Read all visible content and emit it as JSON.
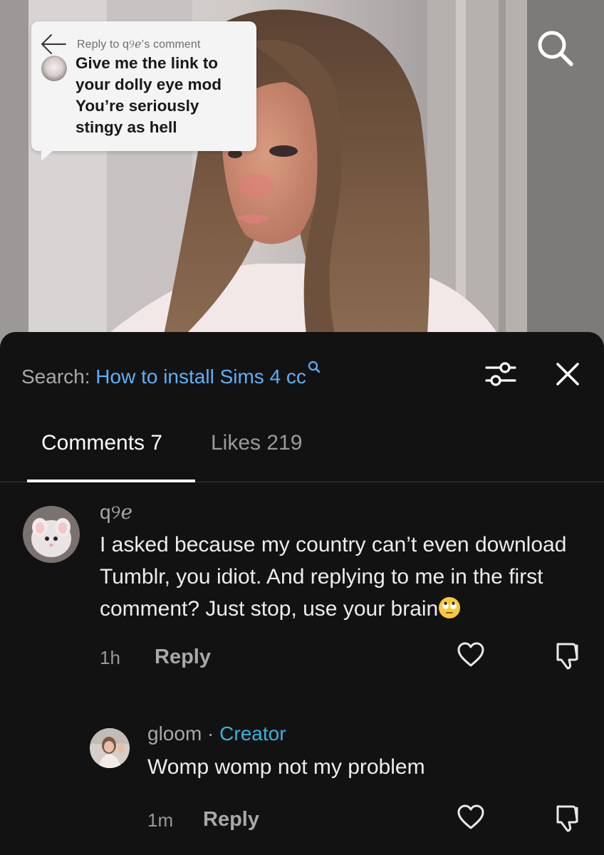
{
  "reply_sticker": {
    "label": "Reply to q୨ℯ’s comment",
    "text": "Give me the link to\nyour dolly eye mod\nYou’re seriously\nstingy as hell"
  },
  "sheet": {
    "search_prefix": "Search:",
    "search_query": "How to install Sims 4 cc",
    "tabs": [
      {
        "label": "Comments 7",
        "active": true
      },
      {
        "label": "Likes 219",
        "active": false
      }
    ]
  },
  "comments": [
    {
      "username": "q୨ℯ",
      "text": "I asked because my country can’t even download Tumblr, you idiot. And replying to me in the first comment? Just stop, use your brain",
      "emoji": "face-with-rolling-eyes",
      "time": "1h",
      "reply_label": "Reply"
    },
    {
      "username": "gloom",
      "separator": "·",
      "badge": "Creator",
      "text": "Womp womp not my problem",
      "time": "1m",
      "reply_label": "Reply"
    }
  ],
  "icons": {
    "top_search": "search-icon",
    "back": "back-arrow-icon",
    "search_magnifier": "search-mini-icon",
    "filter": "filter-sliders-icon",
    "close": "close-icon",
    "heart": "heart-icon",
    "dislike": "dislike-icon"
  },
  "colors": {
    "sheet_background": "#121212",
    "search_query": "#5db1f7",
    "creator_badge": "#3bb2da",
    "tab_active": "#ffffff",
    "tab_inactive": "#9a9a9a"
  }
}
